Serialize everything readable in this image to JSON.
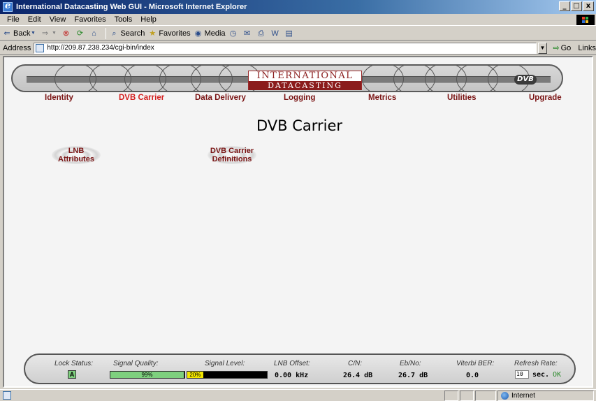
{
  "window": {
    "title": "International Datacasting Web GUI - Microsoft Internet Explorer",
    "controls": [
      "_",
      "□",
      "x"
    ]
  },
  "menu": [
    "File",
    "Edit",
    "View",
    "Favorites",
    "Tools",
    "Help"
  ],
  "toolbar": {
    "back": "Back",
    "search": "Search",
    "favorites": "Favorites",
    "media": "Media"
  },
  "address": {
    "label": "Address",
    "url": "http://209.87.238.234/cgi-bin/index",
    "go": "Go",
    "links": "Links"
  },
  "banner": {
    "brand_top": "INTERNATIONAL",
    "brand_bottom": "DATACASTING",
    "badge": "DVB"
  },
  "nav": [
    {
      "label": "Identity",
      "active": false
    },
    {
      "label": "DVB Carrier",
      "active": true
    },
    {
      "label": "Data Delivery",
      "active": false
    },
    {
      "label": "Logging",
      "active": false
    },
    {
      "label": "Metrics",
      "active": false
    },
    {
      "label": "Utilities",
      "active": false
    },
    {
      "label": "Upgrade",
      "active": false
    }
  ],
  "page": {
    "title": "DVB Carrier",
    "subnav": [
      {
        "line1": "LNB",
        "line2": "Attributes"
      },
      {
        "line1": "DVB Carrier",
        "line2": "Definitions"
      }
    ]
  },
  "status": {
    "lock_status": {
      "label": "Lock Status:",
      "value": "A"
    },
    "signal_quality": {
      "label": "Signal Quality:",
      "value": "99%",
      "fraction": 0.99,
      "color": "#7ed07e"
    },
    "signal_level": {
      "label": "Signal Level:",
      "value": "20%",
      "fraction": 0.2,
      "color": "#f2e600"
    },
    "lnb_offset": {
      "label": "LNB Offset:",
      "value": "0.00 kHz"
    },
    "cn": {
      "label": "C/N:",
      "value": "26.4 dB"
    },
    "ebno": {
      "label": "Eb/No:",
      "value": "26.7 dB"
    },
    "viterbi": {
      "label": "Viterbi BER:",
      "value": "0.0"
    },
    "refresh": {
      "label": "Refresh Rate:",
      "value": "10",
      "unit": "sec.",
      "ok": "OK"
    }
  },
  "statusbar": {
    "zone": "Internet"
  }
}
